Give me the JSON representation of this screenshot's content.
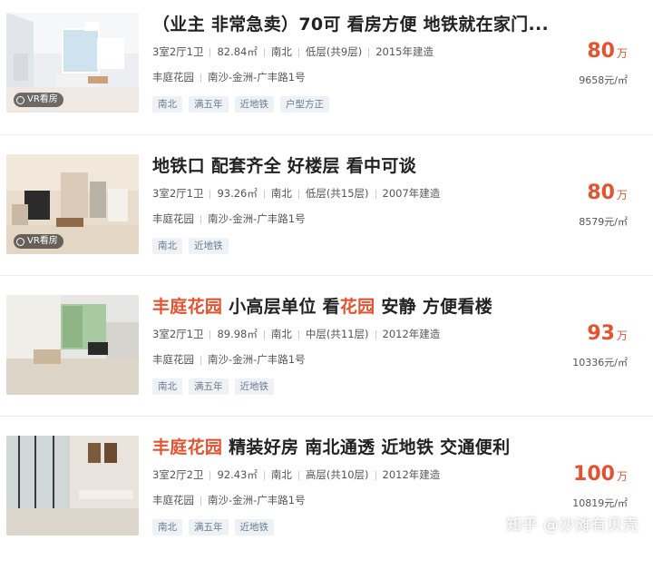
{
  "listings": [
    {
      "title": "（业主 非常急卖）70可 看房方便 地铁就在家门...",
      "title_parts": [
        "（业主 非常急卖）70可 看房方便 地铁就在家门...",
        "",
        "",
        "",
        ""
      ],
      "vr_label": "VR看房",
      "layout": "3室2厅1卫",
      "area": "82.84㎡",
      "orientation": "南北",
      "floor": "低层(共9层)",
      "year": "2015年建造",
      "community": "丰庭花园",
      "address": "南沙-金洲-广丰路1号",
      "tags": [
        "南北",
        "满五年",
        "近地铁",
        "户型方正"
      ],
      "price": "80",
      "price_unit": "万",
      "unit_price": "9658元/㎡"
    },
    {
      "title_parts": [
        "地铁口 配套齐全 好楼层 看中可谈",
        "",
        "",
        "",
        ""
      ],
      "vr_label": "VR看房",
      "layout": "3室2厅1卫",
      "area": "93.26㎡",
      "orientation": "南北",
      "floor": "低层(共15层)",
      "year": "2007年建造",
      "community": "丰庭花园",
      "address": "南沙-金洲-广丰路1号",
      "tags": [
        "南北",
        "近地铁"
      ],
      "price": "80",
      "price_unit": "万",
      "unit_price": "8579元/㎡"
    },
    {
      "title_parts": [
        "丰庭花园",
        " 小高层单位 看",
        "花园",
        " 安静 方便看楼",
        ""
      ],
      "layout": "3室2厅1卫",
      "area": "89.98㎡",
      "orientation": "南北",
      "floor": "中层(共11层)",
      "year": "2012年建造",
      "community": "丰庭花园",
      "address": "南沙-金洲-广丰路1号",
      "tags": [
        "南北",
        "满五年",
        "近地铁"
      ],
      "price": "93",
      "price_unit": "万",
      "unit_price": "10336元/㎡"
    },
    {
      "title_parts": [
        "丰庭花园",
        " 精装好房 南北通透 近地铁 交通便利",
        "",
        "",
        ""
      ],
      "layout": "3室2厅2卫",
      "area": "92.43㎡",
      "orientation": "南北",
      "floor": "高层(共10层)",
      "year": "2012年建造",
      "community": "丰庭花园",
      "address": "南沙-金洲-广丰路1号",
      "tags": [
        "南北",
        "满五年",
        "近地铁"
      ],
      "price": "100",
      "price_unit": "万",
      "unit_price": "10819元/㎡"
    }
  ],
  "watermark": "知乎 @沙滩有贝壳",
  "colors": {
    "accent": "#e4532f",
    "tag_bg": "#eef2f6",
    "tag_text": "#6b7b8c"
  }
}
